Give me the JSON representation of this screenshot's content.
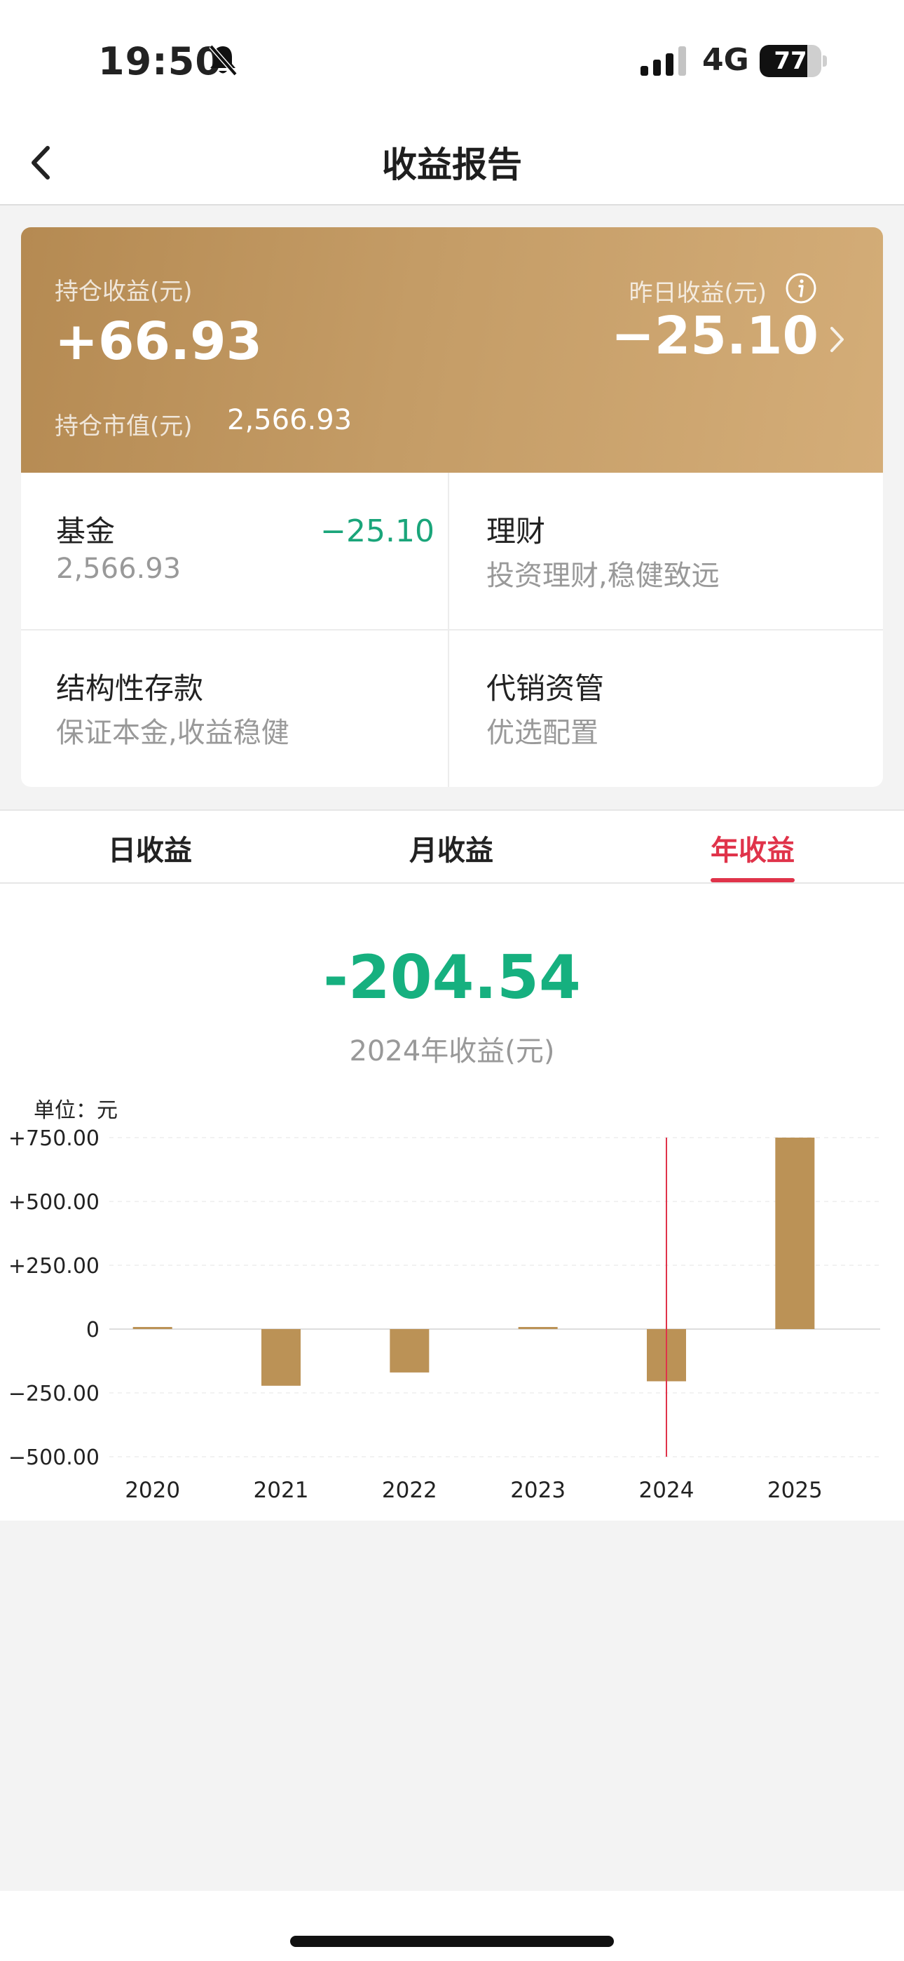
{
  "status_bar": {
    "time": "19:50",
    "network": "4G",
    "battery_pct": "77",
    "battery_level": 0.77
  },
  "nav": {
    "title": "收益报告"
  },
  "summary": {
    "holding_profit_label": "持仓收益(元)",
    "holding_profit_value": "+66.93",
    "market_value_label": "持仓市值(元)",
    "market_value_value": "2,566.93",
    "yesterday_label": "昨日收益(元)",
    "yesterday_value": "−25.10"
  },
  "products": [
    {
      "title": "基金",
      "subtitle": "2,566.93",
      "change": "−25.10"
    },
    {
      "title": "理财",
      "subtitle": "投资理财,稳健致远"
    },
    {
      "title": "结构性存款",
      "subtitle": "保证本金,收益稳健"
    },
    {
      "title": "代销资管",
      "subtitle": "优选配置"
    }
  ],
  "tabs": {
    "items": [
      "日收益",
      "月收益",
      "年收益"
    ],
    "active": 2
  },
  "colors": {
    "gold": "#c49c66",
    "accent_red": "#e0334a",
    "loss_green": "#16b07f",
    "bar": "#bb9256"
  },
  "chart_data": {
    "type": "bar",
    "big_value": "-204.54",
    "big_value_label": "2024年收益(元)",
    "unit_label": "单位：元",
    "categories": [
      "2020",
      "2021",
      "2022",
      "2023",
      "2024",
      "2025"
    ],
    "values": [
      4,
      -222,
      -170,
      3,
      -204.54,
      750
    ],
    "ylim": [
      -500,
      750
    ],
    "yticks": [
      750,
      500,
      250,
      0,
      -250,
      -500
    ],
    "ytick_labels": [
      "+750.00",
      "+500.00",
      "+250.00",
      "0",
      "−250.00",
      "−500.00"
    ],
    "selected_index": 4,
    "grid": true
  }
}
